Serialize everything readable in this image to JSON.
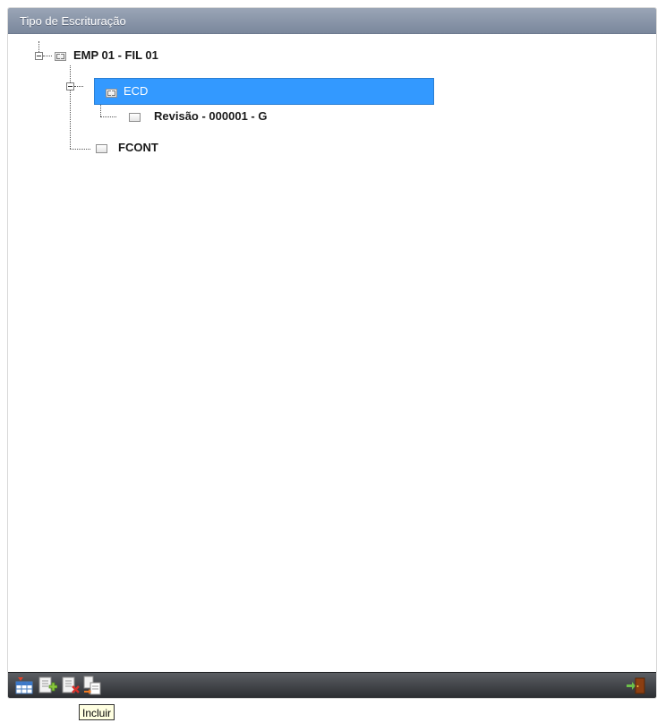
{
  "panel": {
    "title": "Tipo de Escrituração"
  },
  "tree": {
    "root": {
      "label": "EMP 01 - FIL 01",
      "expanded": true
    },
    "children": [
      {
        "label": "ECD",
        "expanded": true,
        "selected": true,
        "children": [
          {
            "label": "Revisão - 000001 - G"
          }
        ]
      },
      {
        "label": "FCONT"
      }
    ]
  },
  "toolbar": {
    "buttons": [
      {
        "icon": "grid-icon"
      },
      {
        "icon": "add-document-icon"
      },
      {
        "icon": "delete-document-icon"
      },
      {
        "icon": "copy-document-icon"
      }
    ],
    "exit_icon": "exit-door-icon"
  },
  "tooltip": {
    "text": "Incluir"
  },
  "colors": {
    "selection": "#3399ff",
    "header": "#8a96a9",
    "toolbar": "#3f4246"
  }
}
